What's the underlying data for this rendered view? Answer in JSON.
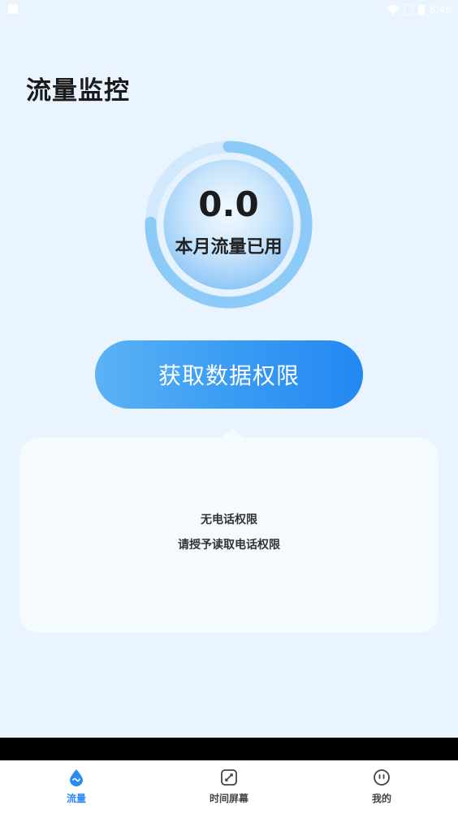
{
  "status_bar": {
    "time": "8:46"
  },
  "page": {
    "title": "流量监控"
  },
  "gauge": {
    "value": "0.0",
    "label": "本月流量已用",
    "accent": "#8ccaf8"
  },
  "action": {
    "button_label": "获取数据权限"
  },
  "info_card": {
    "line1": "无电话权限",
    "line2": "请授予读取电话权限"
  },
  "bottom_nav": {
    "active_color": "#2a8cf2",
    "items": [
      {
        "label": "流量",
        "icon": "traffic-drop-icon",
        "active": true
      },
      {
        "label": "时间屏幕",
        "icon": "screen-time-icon",
        "active": false
      },
      {
        "label": "我的",
        "icon": "profile-face-icon",
        "active": false
      }
    ]
  }
}
